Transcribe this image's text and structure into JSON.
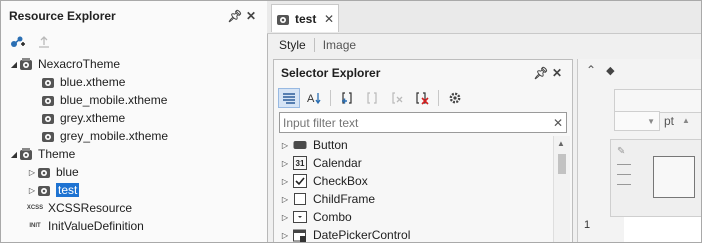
{
  "resource_explorer": {
    "title": "Resource Explorer",
    "tree": [
      {
        "label": "NexacroTheme",
        "expanded": true,
        "icon": "theme-icon",
        "children": [
          {
            "label": "blue.xtheme",
            "icon": "xtheme-file-icon"
          },
          {
            "label": "blue_mobile.xtheme",
            "icon": "xtheme-file-icon"
          },
          {
            "label": "grey.xtheme",
            "icon": "xtheme-file-icon"
          },
          {
            "label": "grey_mobile.xtheme",
            "icon": "xtheme-file-icon"
          }
        ]
      },
      {
        "label": "Theme",
        "expanded": true,
        "icon": "theme-icon",
        "children": [
          {
            "label": "blue",
            "icon": "theme-icon"
          },
          {
            "label": "test",
            "icon": "theme-icon",
            "selected": true
          }
        ]
      },
      {
        "label": "XCSSResource",
        "icon": "xcss-icon",
        "icon_text": "XCSS"
      },
      {
        "label": "InitValueDefinition",
        "icon": "init-icon",
        "icon_text": "INIT"
      }
    ]
  },
  "editor": {
    "tab": {
      "label": "test"
    },
    "subtabs": [
      {
        "label": "Style",
        "active": true
      },
      {
        "label": "Image",
        "active": false
      }
    ]
  },
  "selector_explorer": {
    "title": "Selector Explorer",
    "filter": {
      "placeholder": "Input filter text",
      "value": ""
    },
    "items": [
      {
        "label": "Button",
        "icon": "button-icon"
      },
      {
        "label": "Calendar",
        "icon": "calendar-icon",
        "icon_text": "31"
      },
      {
        "label": "CheckBox",
        "icon": "checkbox-icon"
      },
      {
        "label": "ChildFrame",
        "icon": "childframe-icon"
      },
      {
        "label": "Combo",
        "icon": "combo-icon"
      },
      {
        "label": "DatePickerControl",
        "icon": "datepicker-icon"
      }
    ]
  },
  "properties": {
    "unit": "pt",
    "line_number": "1"
  },
  "colors": {
    "selection": "#1e73d2",
    "accent": "#1e73d2"
  }
}
